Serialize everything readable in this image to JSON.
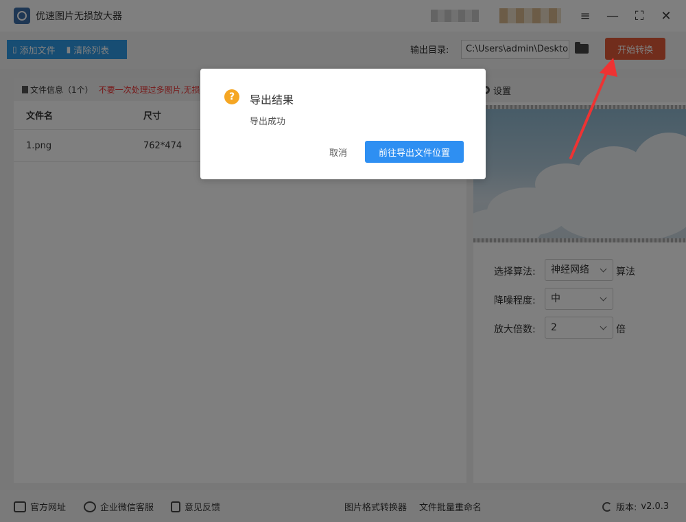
{
  "app": {
    "title": "优速图片无损放大器"
  },
  "window_controls": {
    "menu": "≡",
    "minimize": "—",
    "maximize": "⛶",
    "close": "✕"
  },
  "toolbar": {
    "add_file": "添加文件",
    "clear_list": "清除列表",
    "output_label": "输出目录:",
    "output_path": "C:\\Users\\admin\\Deskto",
    "start": "开始转换"
  },
  "file_list": {
    "info": "文件信息（1个）",
    "warning": "不要一次处理过多图片,无损放",
    "headers": [
      "文件名",
      "尺寸"
    ],
    "rows": [
      {
        "name": "1.png",
        "size": "762*474"
      }
    ]
  },
  "settings": {
    "title": "设置",
    "algorithm_label": "选择算法:",
    "algorithm_value": "神经网络",
    "algorithm_suffix": "算法",
    "denoise_label": "降噪程度:",
    "denoise_value": "中",
    "scale_label": "放大倍数:",
    "scale_value": "2",
    "scale_suffix": "倍"
  },
  "footer": {
    "website": "官方网址",
    "wechat": "企业微信客服",
    "feedback": "意见反馈",
    "format_converter": "图片格式转换器",
    "batch_rename": "文件批量重命名",
    "version_label": "版本:",
    "version": "v2.0.3"
  },
  "dialog": {
    "icon": "?",
    "title": "导出结果",
    "message": "导出成功",
    "cancel": "取消",
    "go": "前往导出文件位置"
  },
  "colors": {
    "primary": "#2e9ae6",
    "start": "#e25a39",
    "warning": "#ee3333",
    "arrow": "#ee3333"
  }
}
